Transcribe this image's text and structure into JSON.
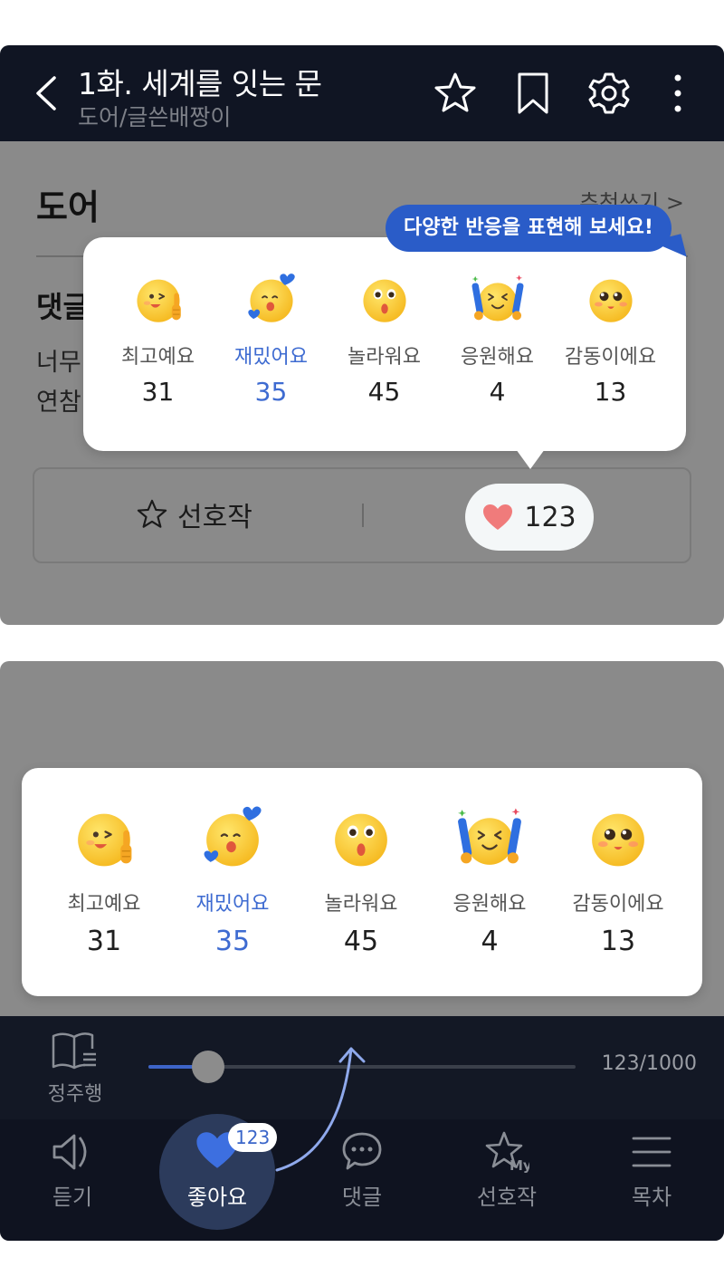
{
  "header": {
    "title": "1화. 세계를 잇는 문",
    "subtitle": "도어/글쓴배짱이"
  },
  "content": {
    "author_name": "도어",
    "recommend_link": "추천쓰기 >",
    "comment_heading": "댓글",
    "comment_line1": "너무",
    "comment_line2": "연참"
  },
  "actions": {
    "favorite_label": "선호작",
    "like_count": "123"
  },
  "tooltip": {
    "text": "다양한 반응을 표현해 보세요!"
  },
  "reactions": [
    {
      "label": "최고예요",
      "count": "31",
      "icon": "thumbs-up-wink-emoji"
    },
    {
      "label": "재밌어요",
      "count": "35",
      "icon": "hearts-emoji",
      "selected": true
    },
    {
      "label": "놀라워요",
      "count": "45",
      "icon": "surprised-emoji"
    },
    {
      "label": "응원해요",
      "count": "4",
      "icon": "cheering-emoji"
    },
    {
      "label": "감동이에요",
      "count": "13",
      "icon": "touched-emoji"
    }
  ],
  "reader": {
    "viewer_label": "정주행",
    "page_indicator": "123/1000",
    "progress": 0.14
  },
  "bottom_nav": {
    "items": [
      {
        "label": "듣기",
        "icon": "speaker-icon"
      },
      {
        "label": "좋아요",
        "icon": "heart-icon",
        "badge": "123"
      },
      {
        "label": "댓글",
        "icon": "comment-icon"
      },
      {
        "label": "선호작",
        "icon": "star-my-icon"
      },
      {
        "label": "목차",
        "icon": "menu-icon"
      }
    ]
  },
  "colors": {
    "accent": "#3e6bd1",
    "tooltip": "#2a5cc8",
    "header_bg": "#101523",
    "nav_bg": "#0f1320",
    "heart_pink": "#f07b7b"
  }
}
